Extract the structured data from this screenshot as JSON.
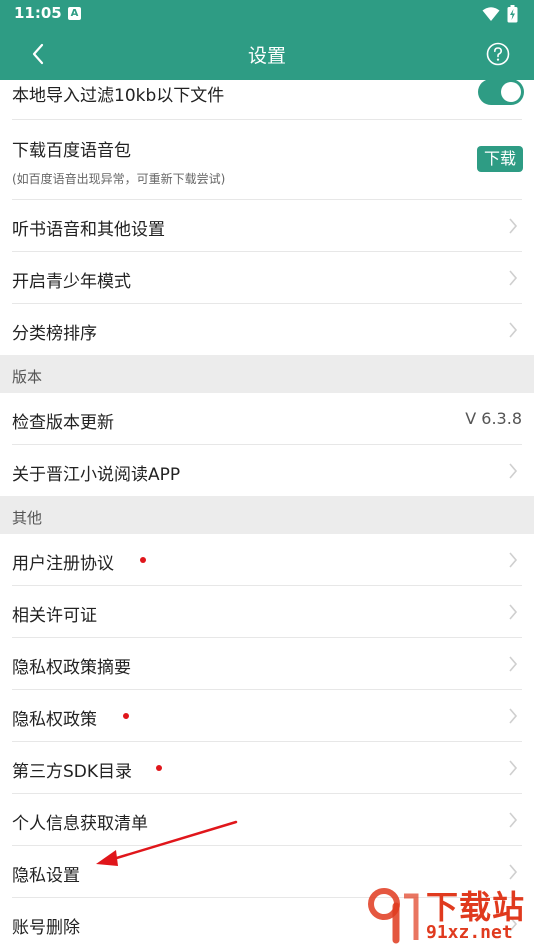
{
  "status_bar": {
    "time": "11:05",
    "notification_glyph": "A"
  },
  "app_bar": {
    "title": "设置",
    "back_icon": "back-arrow-icon",
    "help_icon": "help-circle-icon"
  },
  "settings_top": {
    "filter_small_files": {
      "label": "本地导入过滤10kb以下文件",
      "toggle_on": true
    },
    "baidu_voice": {
      "label": "下载百度语音包",
      "sub": "(如百度语音出现异常，可重新下载尝试)",
      "button": "下载"
    },
    "tts_settings": {
      "label": "听书语音和其他设置"
    },
    "youth_mode": {
      "label": "开启青少年模式"
    },
    "category_sort": {
      "label": "分类榜排序"
    }
  },
  "version_section": {
    "header": "版本",
    "check_update": {
      "label": "检查版本更新",
      "value": "V 6.3.8"
    },
    "about": {
      "label": "关于晋江小说阅读APP"
    }
  },
  "other_section": {
    "header": "其他",
    "items": [
      {
        "label": "用户注册协议",
        "dot": true
      },
      {
        "label": "相关许可证",
        "dot": false
      },
      {
        "label": "隐私权政策摘要",
        "dot": false
      },
      {
        "label": "隐私权政策",
        "dot": true
      },
      {
        "label": "第三方SDK目录",
        "dot": true
      },
      {
        "label": "个人信息获取清单",
        "dot": false
      },
      {
        "label": "隐私设置",
        "dot": false
      },
      {
        "label": "账号删除",
        "dot": false
      }
    ]
  },
  "watermark": {
    "title": "下载站",
    "url": "91xz.net"
  },
  "colors": {
    "accent": "#2e9c84",
    "dot": "#e0161b",
    "arrow": "#e0161b",
    "watermark": "#e03a1e"
  }
}
